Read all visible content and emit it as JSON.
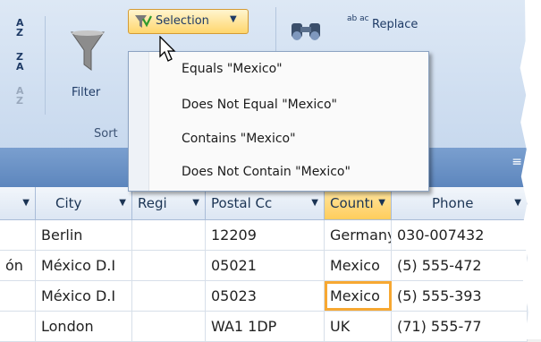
{
  "ribbon": {
    "sort_group_label": "Sort",
    "filter_label": "Filter",
    "selection_label": "Selection",
    "replace_label": "Replace",
    "replace_icon_text": "ab ac"
  },
  "selection_menu": {
    "items": [
      {
        "label": "Equals \"Mexico\""
      },
      {
        "label": "Does Not Equal \"Mexico\""
      },
      {
        "label": "Contains \"Mexico\""
      },
      {
        "label": "Does Not Contain \"Mexico\""
      }
    ]
  },
  "table": {
    "columns": [
      {
        "label": "",
        "has_dropdown": true
      },
      {
        "label": "City"
      },
      {
        "label": "Regi"
      },
      {
        "label": "Postal Cc"
      },
      {
        "label": "Countı"
      },
      {
        "label": "Phone"
      }
    ],
    "rows": [
      [
        "",
        "Berlin",
        "",
        "12209",
        "Germany",
        "030-007432"
      ],
      [
        "ón",
        "México D.I",
        "",
        "05021",
        "Mexico",
        "(5) 555-472"
      ],
      [
        "",
        "México D.I",
        "",
        "05023",
        "Mexico",
        "(5) 555-393"
      ],
      [
        "",
        "London",
        "",
        "WA1 1DP",
        "UK",
        "(71) 555-77"
      ]
    ],
    "selected_cell": {
      "row": 2,
      "column": 4
    }
  },
  "colors": {
    "accent_highlight": "#f7a832",
    "ribbon_bg": "#dde8f5",
    "header_bar": "#6a92c6"
  },
  "icons": [
    "sort-ascending-icon",
    "sort-descending-icon",
    "clear-sort-icon",
    "filter-funnel-icon",
    "selection-filter-icon",
    "find-binoculars-icon",
    "replace-icon",
    "dropdown-arrow-icon",
    "mouse-cursor-icon"
  ]
}
